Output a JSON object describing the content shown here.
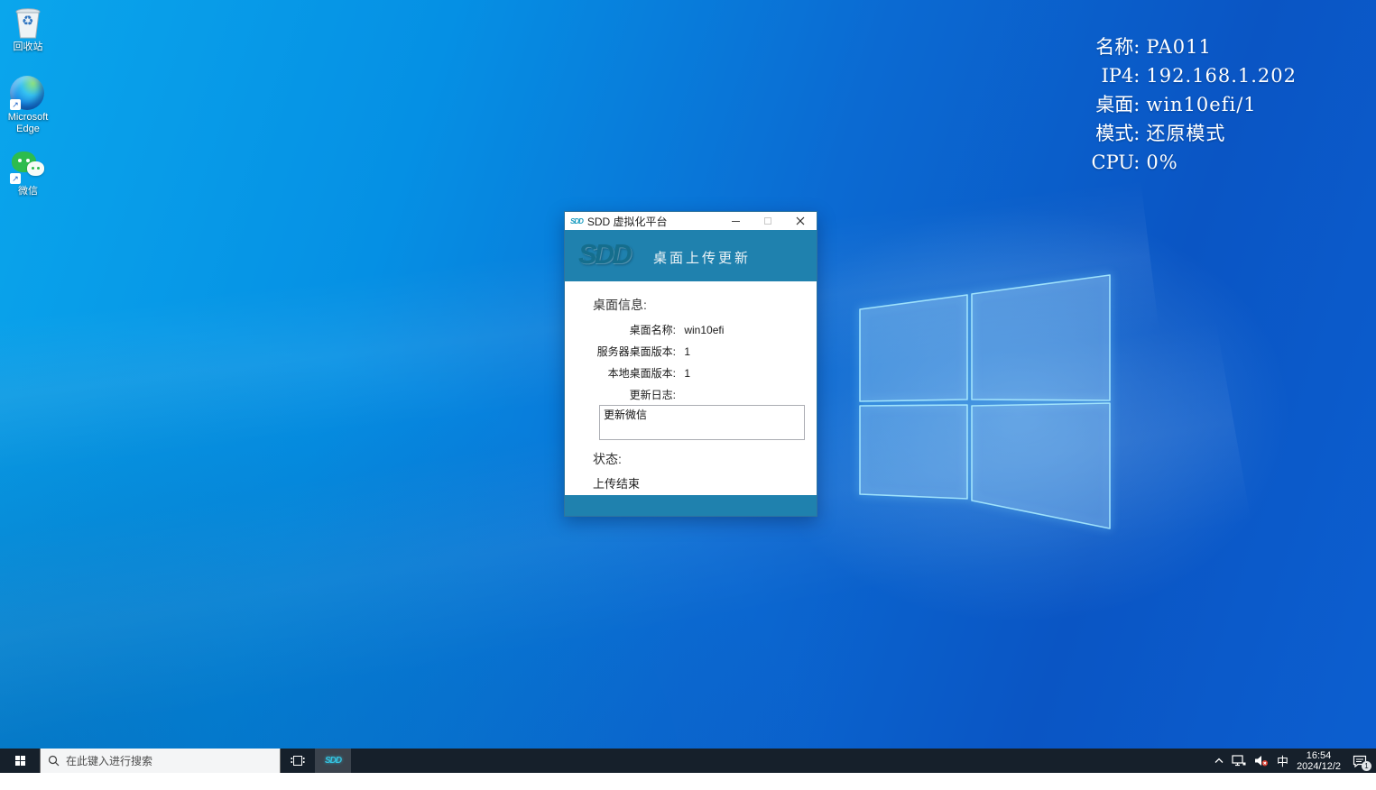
{
  "desktop": {
    "icons": [
      {
        "label": "回收站"
      },
      {
        "label": "Microsoft Edge"
      },
      {
        "label": "微信"
      }
    ],
    "overlay": [
      {
        "label": "名称:",
        "value": "PA011"
      },
      {
        "label": "IP4:",
        "value": "192.168.1.202"
      },
      {
        "label": "桌面:",
        "value": "win10efi/1"
      },
      {
        "label": "模式:",
        "value": "还原模式"
      },
      {
        "label": "CPU:",
        "value": "0%"
      }
    ]
  },
  "dialog": {
    "titlebar": {
      "icon_text": "SDD",
      "title": "SDD 虚拟化平台"
    },
    "header": {
      "logo_text": "SDD",
      "title": "桌面上传更新"
    },
    "info_heading": "桌面信息:",
    "rows": [
      {
        "label": "桌面名称:",
        "value": "win10efi"
      },
      {
        "label": "服务器桌面版本:",
        "value": "1"
      },
      {
        "label": "本地桌面版本:",
        "value": "1"
      },
      {
        "label": "更新日志:",
        "value": ""
      }
    ],
    "log_text": "更新微信",
    "status_heading": "状态:",
    "status_value": "上传结束"
  },
  "taskbar": {
    "search_placeholder": "在此键入进行搜索",
    "app_label": "SDD",
    "tray": {
      "ime": "中",
      "time": "16:54",
      "date": "2024/12/2",
      "badge": "1"
    }
  },
  "colors": {
    "header_blue": "#1f81ae",
    "accent_teal": "#156e8d",
    "taskbar_bg": "#16202b",
    "wechat_green": "#2dbc4e",
    "desktop_blue": "#0b62cc"
  }
}
